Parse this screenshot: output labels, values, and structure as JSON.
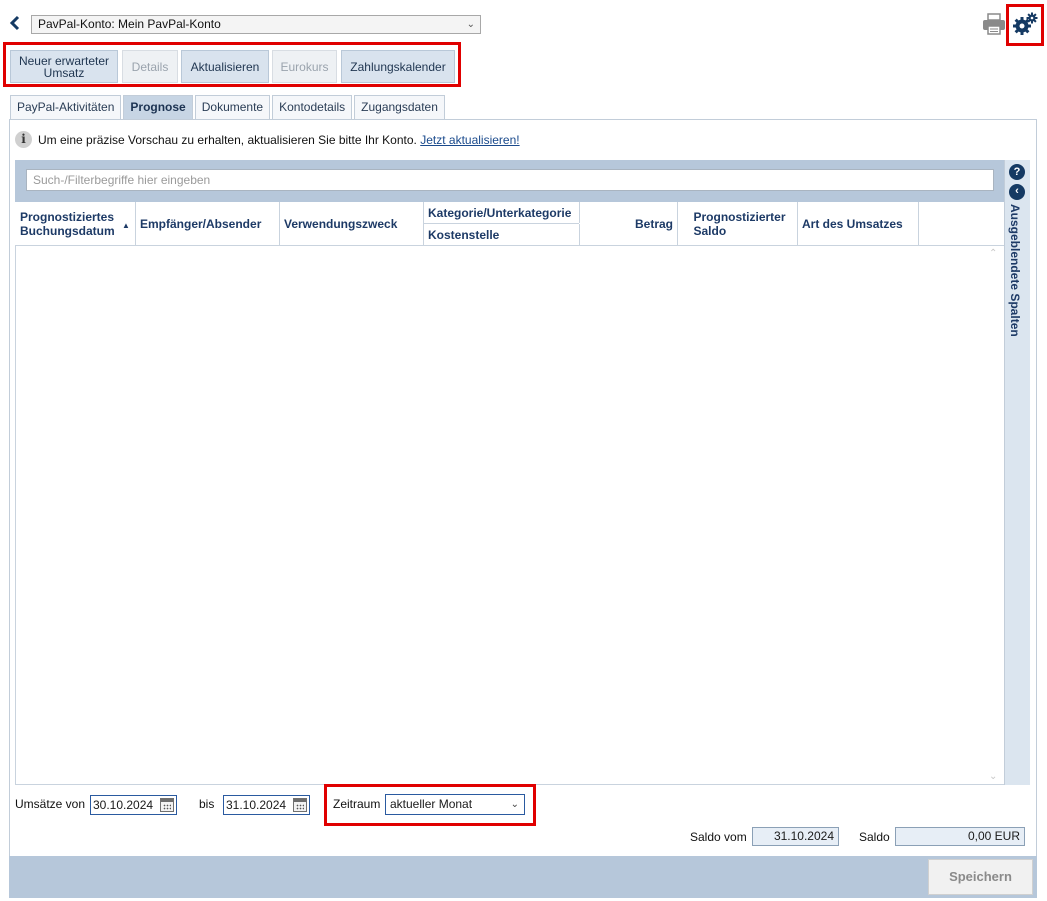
{
  "header": {
    "account_select": "PavPal-Konto: Mein PavPal-Konto"
  },
  "toolbar": {
    "new_expected_line1": "Neuer erwarteter",
    "new_expected_line2": "Umsatz",
    "details": "Details",
    "refresh": "Aktualisieren",
    "eurokurs": "Eurokurs",
    "payment_calendar": "Zahlungskalender"
  },
  "tabs": [
    "PayPal-Aktivitäten",
    "Prognose",
    "Dokumente",
    "Kontodetails",
    "Zugangsdaten"
  ],
  "info": {
    "text": "Um eine präzise Vorschau zu erhalten, aktualisieren Sie bitte Ihr Konto. ",
    "link": "Jetzt aktualisieren!"
  },
  "grid": {
    "search_placeholder": "Such-/Filterbegriffe hier eingeben",
    "columns": {
      "date_line1": "Prognostiziertes",
      "date_line2": "Buchungsdatum",
      "party": "Empfänger/Absender",
      "purpose": "Verwendungszweck",
      "category": "Kategorie/Unterkategorie",
      "cost_center": "Kostenstelle",
      "amount": "Betrag",
      "balance_line1": "Prognostizierter",
      "balance_line2": "Saldo",
      "type": "Art des Umsatzes"
    },
    "hidden_columns_label": "Ausgeblendete Spalten"
  },
  "filter": {
    "from_label": "Umsätze von",
    "from_date": "30.10.2024",
    "to_label": "bis",
    "to_date": "31.10.2024",
    "period_label": "Zeitraum",
    "period_value": "aktueller Monat"
  },
  "balance": {
    "date_label": "Saldo vom",
    "date_value": "31.10.2024",
    "label": "Saldo",
    "value": "0,00 EUR"
  },
  "footer": {
    "save": "Speichern"
  },
  "colors": {
    "highlight": "#e00000",
    "accent": "#153a63",
    "header_band": "#b6c7da"
  }
}
